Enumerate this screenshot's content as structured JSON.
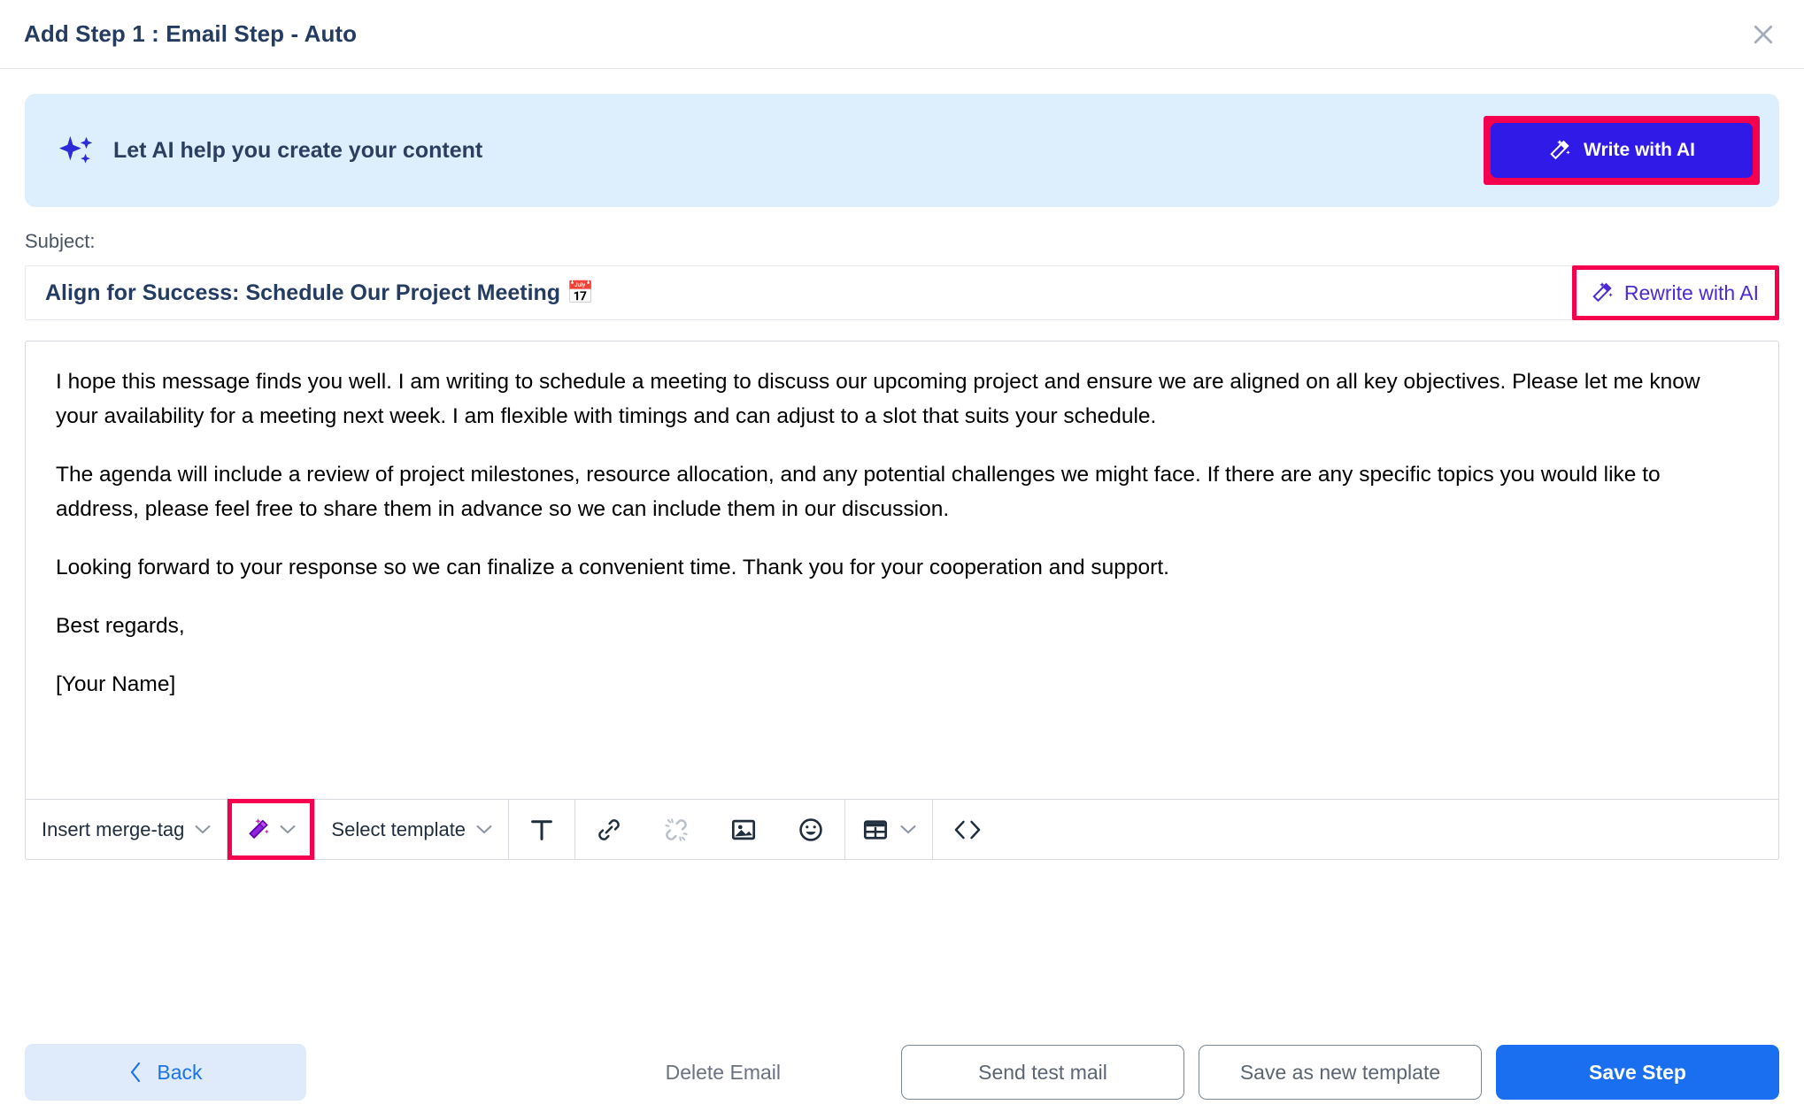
{
  "header": {
    "title": "Add Step 1 : Email Step - Auto",
    "close_icon": "close-icon"
  },
  "ai_banner": {
    "icon": "sparkles-icon",
    "text": "Let AI help you create your content",
    "button_label": "Write with AI",
    "button_icon": "magic-wand-icon",
    "background_color": "#ddeefc",
    "button_color": "#2f1ae8",
    "highlight_color": "#f5004f"
  },
  "subject": {
    "label": "Subject:",
    "value": "Align for Success: Schedule Our Project Meeting 📅",
    "rewrite_label": "Rewrite with AI",
    "rewrite_icon": "magic-wand-icon",
    "rewrite_color": "#4b2ad6"
  },
  "editor": {
    "paragraphs": [
      "I hope this message finds you well. I am writing to schedule a meeting to discuss our upcoming project and ensure we are aligned on all key objectives. Please let me know your availability for a meeting next week. I am flexible with timings and can adjust to a slot that suits your schedule.",
      "The agenda will include a review of project milestones, resource allocation, and any potential challenges we might face. If there are any specific topics you would like to address, please feel free to share them in advance so we can include them in our discussion.",
      "Looking forward to your response so we can finalize a convenient time. Thank you for your cooperation and support.",
      "Best regards,",
      "[Your Name]"
    ]
  },
  "toolbar": {
    "merge_tag_label": "Insert merge-tag",
    "merge_tag_chevron": "chevron-down-icon",
    "ai_wand_icon": "magic-wand-icon",
    "ai_wand_chevron": "chevron-down-icon",
    "select_template_label": "Select template",
    "select_template_chevron": "chevron-down-icon",
    "text_format_icon": "text-format-icon",
    "text_format_label": "T",
    "link_icon": "link-icon",
    "unlink_icon": "unlink-icon",
    "image_icon": "image-icon",
    "emoji_icon": "emoji-icon",
    "table_icon": "table-icon",
    "table_chevron": "chevron-down-icon",
    "code_icon": "code-icon",
    "code_label": "<>"
  },
  "footer": {
    "back_label": "Back",
    "back_icon": "chevron-left-icon",
    "delete_label": "Delete Email",
    "send_test_label": "Send test mail",
    "save_template_label": "Save as new template",
    "save_step_label": "Save Step",
    "save_step_color": "#1a6ef0"
  }
}
